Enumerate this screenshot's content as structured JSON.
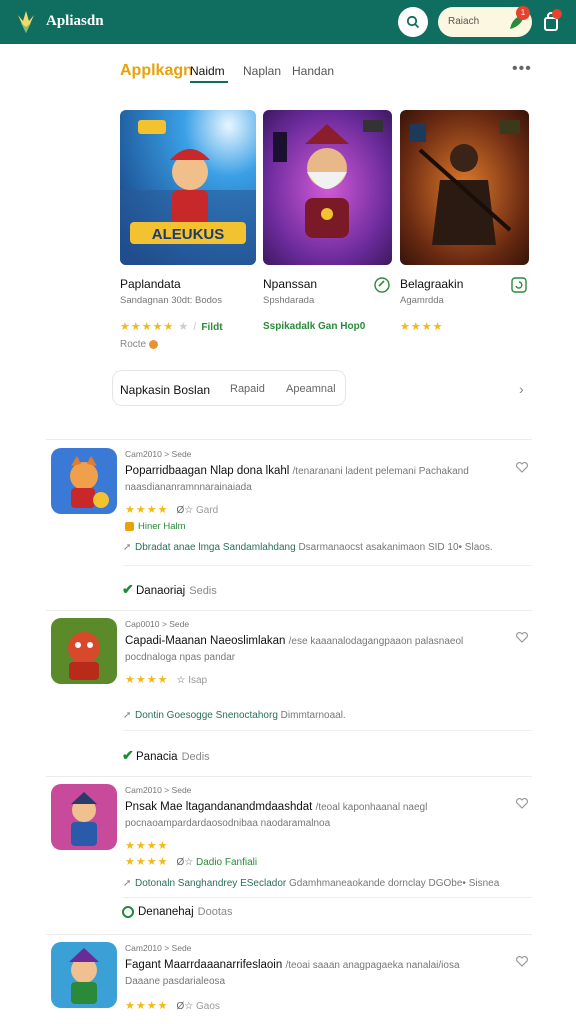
{
  "app": {
    "title": "Apliasdn",
    "search_placeholder": "Raiach",
    "notif_count": "1"
  },
  "tabs": {
    "section_title": "Applkagn",
    "items": [
      "Naidm",
      "Naplan",
      "Handan"
    ],
    "more": "•••"
  },
  "featured": [
    {
      "name": "Paplandata",
      "sub": "Sandagnan 30dt: Bodos",
      "stars": "★★★★★",
      "tag": "Fildt",
      "art_text": "ALEUKUS"
    },
    {
      "name": "Npanssan",
      "sub": "Spshdarada",
      "stars": "",
      "tag": "Sspikadalk  Gan  Hop0",
      "art_text": ""
    },
    {
      "name": "Belagraakin",
      "sub": "Agamrdda",
      "stars": "★★★★",
      "tag": "",
      "art_text": ""
    }
  ],
  "featured_footer": "Rocte",
  "filters": {
    "main": "Napkasin  Boslan",
    "items": [
      "Rapaid",
      "Apeamnal"
    ]
  },
  "list": [
    {
      "meta": "Cam2010 > Sede",
      "title": "Poparridbaagan Nlap dona lkahl",
      "title_desc": "/tenaranani ladent pelemani Pachakand",
      "desc2": "naasdiananramnnarainaiada",
      "stars": "★★★★",
      "star_meta": "Gard",
      "extra": "Hiner Halm",
      "line_green": "Dbradat anae lmga Sandamlahdang",
      "line_gray": "Dsarmanaocst asakanimaon SID 10• Slaos.",
      "status": "Danaoriaj",
      "status2": "Sedis"
    },
    {
      "meta": "Cap0010 > Sede",
      "title": "Capadi-Maanan Naeoslimlakan",
      "title_desc": "/ese kaaanalodagangpaaon palasnaeol",
      "desc2": "pocdnaloga npas pandar",
      "stars": "★★★★",
      "star_meta": "Isap",
      "extra": "",
      "line_green": "Dontin Goesogge Snenoctahorg",
      "line_gray": "Dimmtarnoaal.",
      "status": "Panacia",
      "status2": "Dedis"
    },
    {
      "meta": "Cam2010 > Sede",
      "title": "Pnsak Mae ltagandanandmdaashdat",
      "title_desc": "/teoal kaponhaanal naegl",
      "desc2": "pocnaoampardardaosodnibaa naodaramalnoa",
      "stars": "★★★★",
      "star_meta": "Dadio  Fanfiali",
      "extra": "",
      "line_green": "Dotonaln Sanghandrey ESeclador",
      "line_gray": "Gdamhmaneaokande dornclay DGObe• Sisnea",
      "status": "Denanehaj",
      "status2": "Dootas"
    },
    {
      "meta": "Cam2010 > Sede",
      "title": "Fagant Maarrdaaanarrifeslaoin",
      "title_desc": "/teoai saaan anagpagaeka nanalai/iosa",
      "desc2": "Daaane pasdarialeosa",
      "stars": "★★★★",
      "star_meta": "Gaos",
      "extra": "",
      "line_green": "",
      "line_gray": "",
      "status": "",
      "status2": ""
    }
  ]
}
